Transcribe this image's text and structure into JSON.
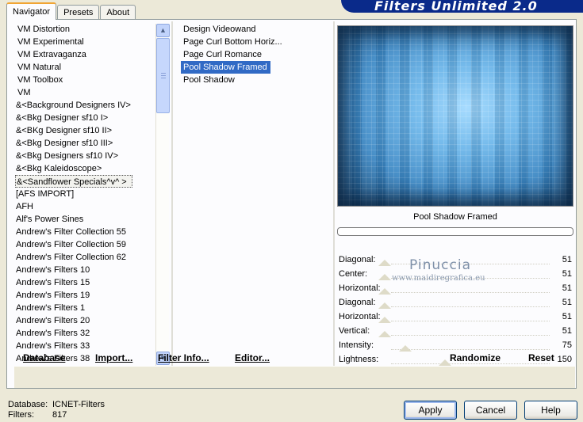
{
  "tabs": [
    "Navigator",
    "Presets",
    "About"
  ],
  "banner_title": "Filters Unlimited 2.0",
  "categories": [
    "VM Distortion",
    "VM Experimental",
    "VM Extravaganza",
    "VM Natural",
    "VM Toolbox",
    "VM",
    "&<Background Designers IV>",
    "&<Bkg Designer sf10 I>",
    "&<BKg Designer sf10 II>",
    "&<Bkg Designer sf10 III>",
    "&<Bkg Designers sf10 IV>",
    "&<Bkg Kaleidoscope>",
    "&<Sandflower Specials^v^ >",
    "[AFS IMPORT]",
    "AFH",
    "Alf's Power Sines",
    "Andrew's Filter Collection 55",
    "Andrew's Filter Collection 59",
    "Andrew's Filter Collection 62",
    "Andrew's Filters 10",
    "Andrew's Filters 15",
    "Andrew's Filters 19",
    "Andrew's Filters 1",
    "Andrew's Filters 20",
    "Andrew's Filters 32",
    "Andrew's Filters 33",
    "Andrew's Filters 38"
  ],
  "filters": [
    "Design Videowand",
    "Page Curl Bottom Horiz...",
    "Page Curl Romance",
    "Pool Shadow Framed",
    "Pool Shadow"
  ],
  "selected_filter": "Pool Shadow Framed",
  "params": [
    {
      "label": "Diagonal:",
      "value": "51"
    },
    {
      "label": "Center:",
      "value": "51"
    },
    {
      "label": "Horizontal:",
      "value": "51"
    },
    {
      "label": "Diagonal:",
      "value": "51"
    },
    {
      "label": "Horizontal:",
      "value": "51"
    },
    {
      "label": "Vertical:",
      "value": "51"
    },
    {
      "label": "Intensity:",
      "value": "75"
    },
    {
      "label": "Lightness:",
      "value": "150"
    }
  ],
  "watermark": {
    "name": "Pinuccia",
    "site": "www.maidiregrafica.eu"
  },
  "actions": {
    "database": "Database",
    "import": "Import...",
    "filter_info": "Filter Info...",
    "editor": "Editor...",
    "randomize": "Randomize",
    "reset": "Reset"
  },
  "status": {
    "database_label": "Database:",
    "database_value": "ICNET-Filters",
    "filters_label": "Filters:",
    "filters_value": "817"
  },
  "buttons": {
    "apply": "Apply",
    "cancel": "Cancel",
    "help": "Help"
  }
}
